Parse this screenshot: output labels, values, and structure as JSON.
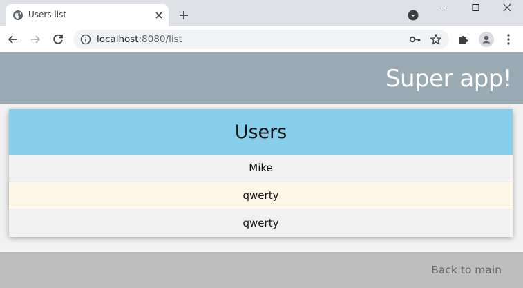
{
  "browser": {
    "tab": {
      "title": "Users list"
    },
    "address": {
      "host": "localhost",
      "path": ":8080/list"
    }
  },
  "app": {
    "title": "Super app!",
    "users_card": {
      "title": "Users",
      "users": [
        {
          "name": "Mike"
        },
        {
          "name": "qwerty"
        },
        {
          "name": "qwerty"
        }
      ]
    },
    "footer": {
      "back_label": "Back to main"
    }
  },
  "colors": {
    "header": "#99aab3",
    "card_header": "#87ceeb",
    "row_alt": "#fdf5e6",
    "footer": "#bebebe"
  }
}
